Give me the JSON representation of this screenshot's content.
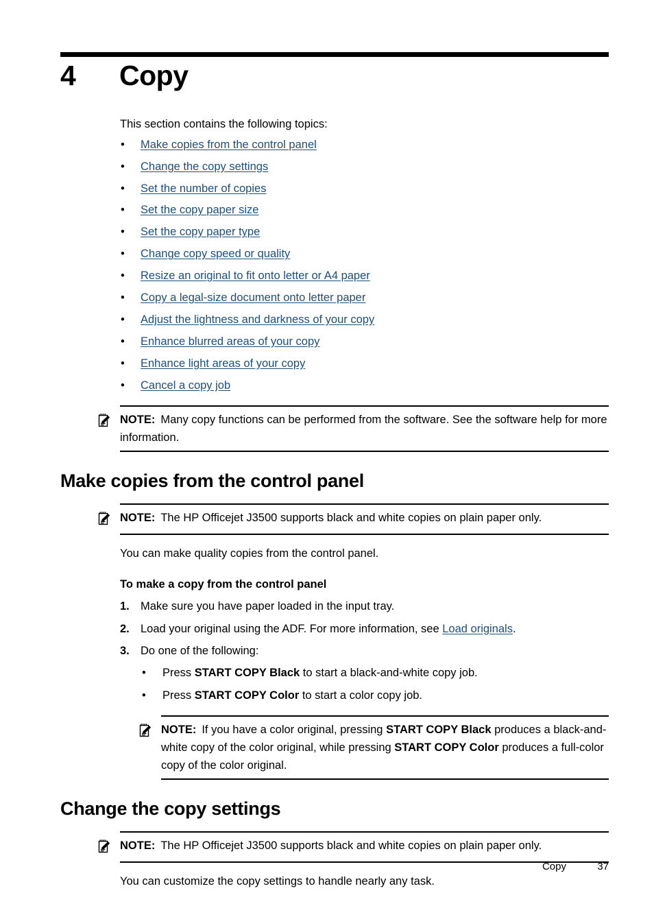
{
  "chapter": {
    "number": "4",
    "title": "Copy"
  },
  "intro": "This section contains the following topics:",
  "topics": [
    {
      "label": "Make copies from the control panel"
    },
    {
      "label": "Change the copy settings"
    },
    {
      "label": "Set the number of copies"
    },
    {
      "label": "Set the copy paper size"
    },
    {
      "label": "Set the copy paper type"
    },
    {
      "label": "Change copy speed or quality"
    },
    {
      "label": "Resize an original to fit onto letter or A4 paper"
    },
    {
      "label": "Copy a legal-size document onto letter paper"
    },
    {
      "label": "Adjust the lightness and darkness of your copy"
    },
    {
      "label": "Enhance blurred areas of your copy"
    },
    {
      "label": "Enhance light areas of your copy"
    },
    {
      "label": "Cancel a copy job"
    }
  ],
  "bullet_glyph": "•",
  "note_label": "NOTE:",
  "note_icon_name": "note-pad-pencil-icon",
  "notes": {
    "intro_note": "Many copy functions can be performed from the software. See the software help for more information.",
    "make_copies_note": "The HP Officejet J3500 supports black and white copies on plain paper only.",
    "start_copy_note": {
      "part1": "If you have a color original, pressing ",
      "bold1": "START COPY Black",
      "part2": " produces a black-and-white copy of the color original, while pressing ",
      "bold2": "START COPY Color",
      "part3": " produces a full-color copy of the color original."
    },
    "copy_settings_note": "The HP Officejet J3500 supports black and white copies on plain paper only."
  },
  "sections": [
    {
      "heading": "Make copies from the control panel",
      "body": "You can make quality copies from the control panel.",
      "procedure_title": "To make a copy from the control panel",
      "steps": [
        {
          "num": "1.",
          "text": "Make sure you have paper loaded in the input tray."
        },
        {
          "num": "2.",
          "text_before": "Load your original using the ADF. For more information, see ",
          "link": "Load originals",
          "text_after": "."
        },
        {
          "num": "3.",
          "text": "Do one of the following:"
        }
      ],
      "substeps": [
        {
          "before": "Press ",
          "bold": "START COPY Black",
          "after": " to start a black-and-white copy job."
        },
        {
          "before": "Press ",
          "bold": "START COPY Color",
          "after": " to start a color copy job."
        }
      ]
    },
    {
      "heading": "Change the copy settings",
      "body": "You can customize the copy settings to handle nearly any task."
    }
  ],
  "footer": {
    "label": "Copy",
    "page": "37"
  },
  "colors": {
    "link": "#1b4f7e",
    "text": "#000000",
    "rule": "#000000"
  }
}
